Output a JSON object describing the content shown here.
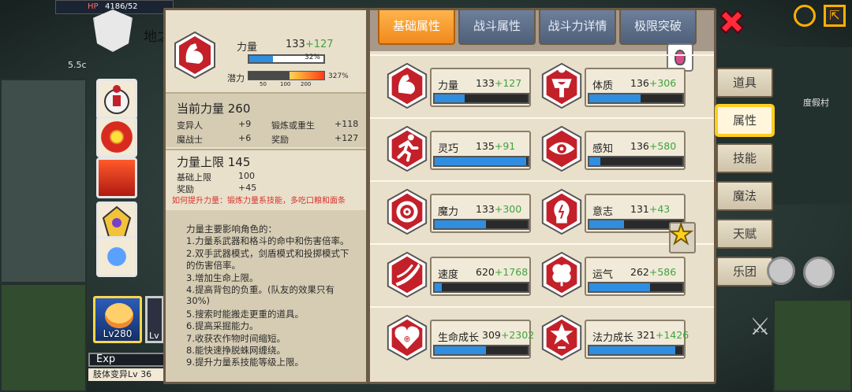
{
  "hud": {
    "hp_tag": "HP",
    "hp_value": "4186/52",
    "speed_label": "5.5c",
    "map_name": "度假村"
  },
  "guild": {
    "name": "地之"
  },
  "character": {
    "level": "Lv280",
    "exp_label": "Exp",
    "mutation_label": "肢体变异Lv 36",
    "second_card_level": "Lv"
  },
  "detail": {
    "stat_name": "力量",
    "stat_base": "133",
    "stat_bonus": "+127",
    "bar_percent": 32,
    "bar_percent_label": "32%",
    "potential_label": "潜力",
    "potential_ticks": [
      "50",
      "100",
      "200"
    ],
    "potential_percent": 327,
    "potential_percent_label": "327%",
    "current_title": "当前力量 260",
    "current_rows": [
      {
        "label": "变异人",
        "value": "+9",
        "label2": "锻炼或重生",
        "value2": "+118"
      },
      {
        "label": "魔战士",
        "value": "+6",
        "label2": "奖励",
        "value2": "+127"
      }
    ],
    "cap_title": "力量上限 145",
    "cap_rows": [
      {
        "label": "基础上限",
        "value": "100"
      },
      {
        "label": "奖励",
        "value": "+45"
      }
    ],
    "how_to": "如何提升力量：锻炼力量系技能，多吃口粮和面条",
    "description": [
      "力量主要影响角色的：",
      "1.力量系武器和格斗的命中和伤害倍率。",
      "2.双手武器模式，剑盾模式和投掷模式下",
      "的伤害倍率。",
      "3.增加生命上限。",
      "4.提高背包的负重。(队友的效果只有",
      "30%)",
      "5.搜索时能搬走更重的道具。",
      "6.提高采掘能力。",
      "7.收获农作物时间缩短。",
      "8.能快速挣脱蛛网缠绕。",
      "9.提升力量系技能等级上限。"
    ]
  },
  "tabs": [
    {
      "label": "基础属性",
      "active": true
    },
    {
      "label": "战斗属性",
      "active": false
    },
    {
      "label": "战斗力详情",
      "active": false
    },
    {
      "label": "极限突破",
      "active": false
    }
  ],
  "attributes": [
    {
      "name": "力量",
      "base": "133",
      "bonus": "+127",
      "fill": 0.32,
      "icon": "arm-icon"
    },
    {
      "name": "体质",
      "base": "136",
      "bonus": "+306",
      "fill": 0.55,
      "icon": "body-icon"
    },
    {
      "name": "灵巧",
      "base": "135",
      "bonus": "+91",
      "fill": 0.98,
      "icon": "runner-icon"
    },
    {
      "name": "感知",
      "base": "136",
      "bonus": "+580",
      "fill": 0.12,
      "icon": "eye-icon"
    },
    {
      "name": "魔力",
      "base": "133",
      "bonus": "+300",
      "fill": 0.55,
      "icon": "spiral-icon"
    },
    {
      "name": "意志",
      "base": "131",
      "bonus": "+43",
      "fill": 0.37,
      "icon": "head-icon"
    },
    {
      "name": "速度",
      "base": "620",
      "bonus": "+1768",
      "fill": 0.08,
      "icon": "speed-icon"
    },
    {
      "name": "运气",
      "base": "262",
      "bonus": "+586",
      "fill": 0.65,
      "icon": "clover-icon"
    },
    {
      "name": "生命成长",
      "base": "309",
      "bonus": "+2302",
      "fill": 0.55,
      "icon": "heart-icon"
    },
    {
      "name": "法力成长",
      "base": "321",
      "bonus": "+1426",
      "fill": 0.92,
      "icon": "mana-icon"
    }
  ],
  "side_nav": [
    {
      "label": "道具",
      "active": false
    },
    {
      "label": "属性",
      "active": true
    },
    {
      "label": "技能",
      "active": false
    },
    {
      "label": "魔法",
      "active": false
    },
    {
      "label": "天赋",
      "active": false
    },
    {
      "label": "乐团",
      "active": false
    }
  ],
  "colors": {
    "bonus": "#3fa33f",
    "bar_fill": "#2f8ee0",
    "icon_red": "#c4202a",
    "tab_active": "#f08a1e",
    "hint_red": "#d8322a"
  }
}
